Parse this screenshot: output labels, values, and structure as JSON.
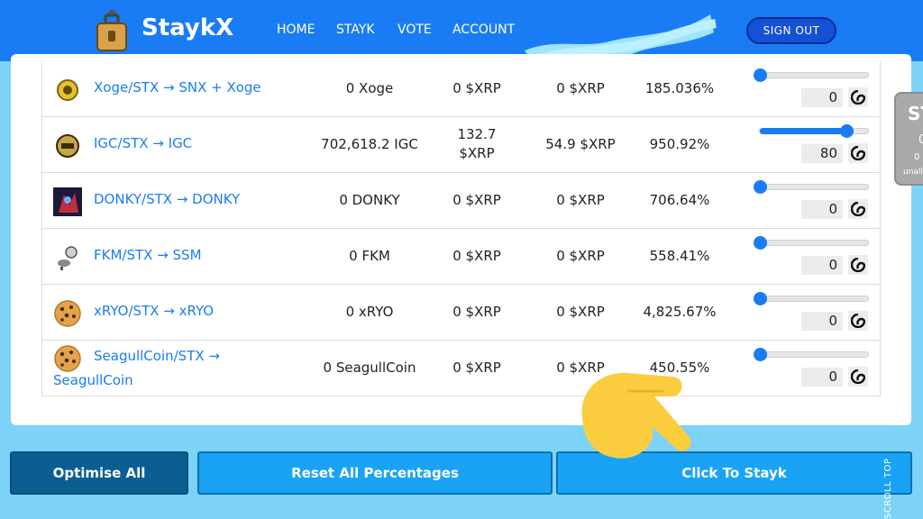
{
  "header": {
    "brand": "StaykX",
    "nav": [
      "HOME",
      "STAYK",
      "VOTE",
      "ACCOUNT"
    ],
    "sign_out": "SIGN OUT"
  },
  "rows": [
    {
      "pair": "Xoge/STX → SNX + Xoge",
      "staked": "0 Xoge",
      "col2": "0 $XRP",
      "col3": "0 $XRP",
      "apy": "185.036%",
      "percent_value": "0",
      "slider": 0,
      "icon": "xoge-token-icon"
    },
    {
      "pair": "IGC/STX → IGC",
      "staked": "702,618.2 IGC",
      "col2_line1": "132.7",
      "col2_line2": "$XRP",
      "col3": "54.9 $XRP",
      "apy": "950.92%",
      "percent_value": "80",
      "slider": 0.8,
      "icon": "igc-token-icon"
    },
    {
      "pair": "DONKY/STX → DONKY",
      "staked": "0 DONKY",
      "col2": "0 $XRP",
      "col3": "0 $XRP",
      "apy": "706.64%",
      "percent_value": "0",
      "slider": 0,
      "icon": "donky-token-icon"
    },
    {
      "pair": "FKM/STX → SSM",
      "staked": "0 FKM",
      "col2": "0 $XRP",
      "col3": "0 $XRP",
      "apy": "558.41%",
      "percent_value": "0",
      "slider": 0,
      "icon": "fkm-token-icon"
    },
    {
      "pair": "xRYO/STX → xRYO",
      "staked": "0 xRYO",
      "col2": "0 $XRP",
      "col3": "0 $XRP",
      "apy": "4,825.67%",
      "percent_value": "0",
      "slider": 0,
      "icon": "cookie-icon"
    },
    {
      "pair_line1": "SeagullCoin/STX →",
      "pair_line2": "SeagullCoin",
      "staked": "0 SeagullCoin",
      "col2": "0 $XRP",
      "col3": "0 $XRP",
      "apy": "450.55%",
      "percent_value": "0",
      "slider": 0,
      "icon": "cookie-icon"
    }
  ],
  "side_widget": {
    "line1": "ST",
    "line2": "0",
    "line3": "0 ",
    "line4": "unall"
  },
  "buttons": {
    "optimise": "Optimise All",
    "reset": "Reset All Percentages",
    "stayk": "Click To Stayk"
  },
  "scroll_top": "SCROLL TOP",
  "colors": {
    "accent": "#1a7cf5",
    "header": "#1a7cf5",
    "background": "#7dd3f7"
  }
}
